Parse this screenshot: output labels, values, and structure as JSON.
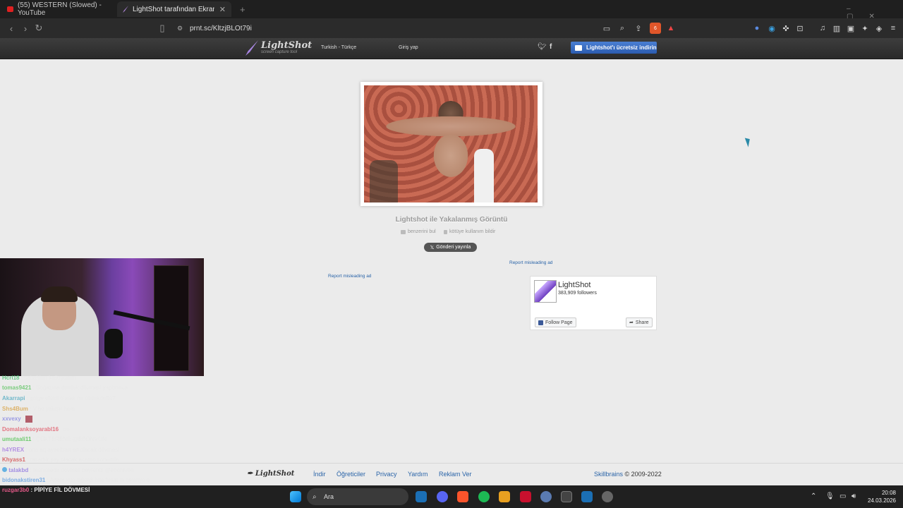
{
  "browser": {
    "tabs": [
      {
        "label": "(55) WESTERN (Slowed) - YouTube",
        "active": false
      },
      {
        "label": "LightShot tarafından Ekran Görü",
        "active": true
      }
    ],
    "new_tab": "+",
    "url": "prnt.sc/KltzjBLOt79i",
    "brave_badge": "6"
  },
  "header": {
    "logo_title": "LightShot",
    "logo_tagline": "screen capture tool",
    "language": "Turkish - Türkçe",
    "login": "Giriş yap",
    "download_button": "Lightshot'ı ücretsiz indirin"
  },
  "main": {
    "caption": "Lightshot ile Yakalanmış Görüntü",
    "find_similar": "benzerini bul",
    "report_abuse": "kötüye kullanım bildir",
    "tweet_button": "Gönderi yayınla",
    "report_ad_1": "Report misleading ad",
    "report_ad_2": "Report misleading ad"
  },
  "facebook": {
    "page_name": "LightShot",
    "followers": "383,909 followers",
    "follow_button": "Follow Page",
    "share_button": "Share"
  },
  "chat": [
    {
      "user": "Hcrl18",
      "text": ": sabahları kalkıyorum",
      "color": "#3fbf6a"
    },
    {
      "user": "tomas9421",
      "text": ": Boğazına durduk dövmesi yaptırınca",
      "color": "#56c25a"
    },
    {
      "user": "Akarrapi",
      "text": ": gölge efekti olarak mı olidakdefte?",
      "color": "#4aa8c0"
    },
    {
      "user": "Shs4Bum",
      "text": ": Vibe yakışır hem",
      "color": "#d8a040"
    },
    {
      "user": "xxvexy",
      "text": ":",
      "color": "#8080e0"
    },
    {
      "user": "Domalanksoyarabl16",
      "text": ": oo",
      "color": "#e05060"
    },
    {
      "user": "umutaali11",
      "text": ": ÇÜKTERENE @EBONVON",
      "color": "#46c046"
    },
    {
      "user": "h4YREX",
      "text": ": ona aq ayeeitran en olacak dövmesi",
      "color": "#a070e0"
    },
    {
      "user": "Khyass1",
      "text": ": rasatblr şey olacak ecamo sonunda",
      "color": "#d04040"
    },
    {
      "user": "talakbd",
      "text": ": memleedir dövmeli beyfendi @ebonivon",
      "color": "#8a70e0"
    },
    {
      "user": "bidonakstiren31",
      "text": ": Adam kuş diğerdi bile fırsat ıa çeviriyo o",
      "color": "#5a9ae0"
    },
    {
      "user": "ruzgar3b0",
      "text": ": PİPİYE FİL DÖVMESİ",
      "color": "#e85a8a"
    }
  ],
  "footer": {
    "logo": "LightShot",
    "links": [
      "İndir",
      "Öğreticiler",
      "Privacy",
      "Yardım",
      "Reklam Ver"
    ],
    "copyright_link": "Skillbrains",
    "copyright_text": "© 2009-2022"
  },
  "taskbar": {
    "search_placeholder": "Ara",
    "time": "20:08",
    "date": "24.03.2026"
  }
}
